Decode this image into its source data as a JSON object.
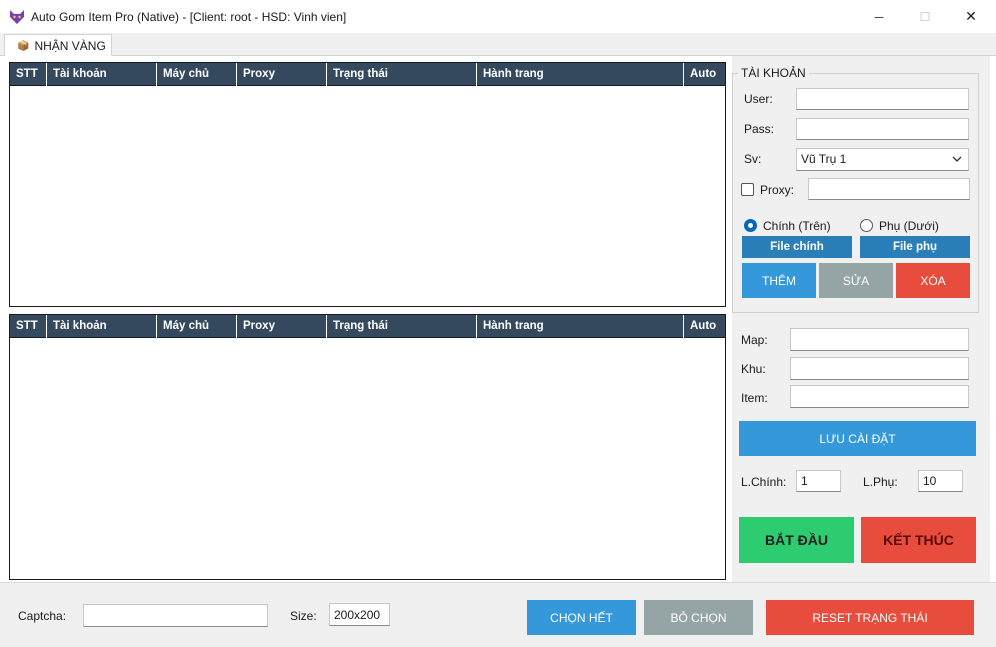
{
  "window": {
    "title": "Auto Gom Item Pro (Native) - [Client: root - HSD: Vinh vien]",
    "minimize_glyph": "─",
    "maximize_glyph": "☐",
    "close_glyph": "✕"
  },
  "tabs": [
    {
      "label": "NHẬN VÀNG",
      "icon": "package-icon",
      "icon_glyph": "📦"
    }
  ],
  "table_top": {
    "columns": [
      "STT",
      "Tài khoản",
      "Máy chủ",
      "Proxy",
      "Trạng thái",
      "Hành trang",
      "Auto"
    ],
    "rows": []
  },
  "table_bottom": {
    "columns": [
      "STT",
      "Tài khoản",
      "Máy chủ",
      "Proxy",
      "Trạng thái",
      "Hành trang",
      "Auto"
    ],
    "rows": []
  },
  "account": {
    "group_title": "TÀI KHOẢN",
    "user_label": "User:",
    "user_value": "",
    "pass_label": "Pass:",
    "pass_value": "",
    "server_label": "Sv:",
    "server_value": "Vũ Trụ 1",
    "proxy_label": "Proxy:",
    "proxy_checked": false,
    "proxy_value": "",
    "radio_main_label": "Chính (Trên)",
    "radio_sub_label": "Phụ (Dưới)",
    "radio_selected": "main",
    "file_main_label": "File chính",
    "file_sub_label": "File phụ",
    "add_label": "THÊM",
    "edit_label": "SỬA",
    "delete_label": "XÓA"
  },
  "settings": {
    "map_label": "Map:",
    "map_value": "",
    "zone_label": "Khu:",
    "zone_value": "",
    "item_label": "Item:",
    "item_value": "",
    "save_label": "LƯU CÀI ĐẶT",
    "main_count_label": "L.Chính:",
    "main_count_value": "1",
    "sub_count_label": "L.Phụ:",
    "sub_count_value": "10",
    "start_label": "BẮT ĐẦU",
    "stop_label": "KẾT THÚC"
  },
  "bottom": {
    "captcha_label": "Captcha:",
    "captcha_value": "",
    "size_label": "Size:",
    "size_value": "200x200",
    "select_all_label": "CHỌN HẾT",
    "deselect_label": "BỎ CHỌN",
    "reset_label": "RESET TRẠNG THÁI"
  },
  "colors": {
    "header_bg": "#34495e",
    "blue": "#3498db",
    "gray": "#95a5a6",
    "red": "#e74c3c",
    "green": "#2ecc71",
    "start_text": "#1e1e1e",
    "stop_text": "#5a0a0a"
  }
}
